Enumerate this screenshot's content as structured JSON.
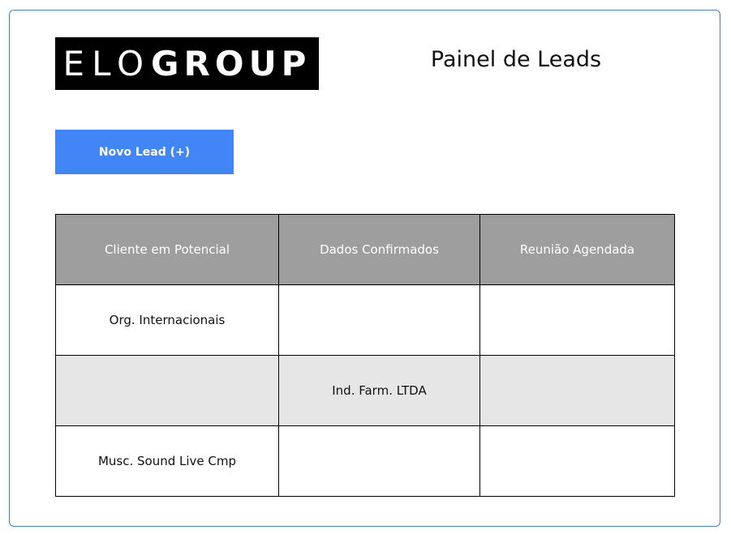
{
  "logo": {
    "part1": "ELO",
    "part2": "GROUP"
  },
  "header": {
    "title": "Painel de Leads"
  },
  "toolbar": {
    "new_lead_label": "Novo Lead (+)"
  },
  "table": {
    "columns": [
      "Cliente em Potencial",
      "Dados Confirmados",
      "Reunião Agendada"
    ],
    "rows": [
      [
        "Org. Internacionais",
        "",
        ""
      ],
      [
        "",
        "Ind. Farm. LTDA",
        ""
      ],
      [
        "Musc. Sound Live Cmp",
        "",
        ""
      ]
    ]
  },
  "colors": {
    "button": "#4285f4",
    "header_bg": "#9e9e9e",
    "alt_row_bg": "#e6e6e6",
    "frame_border": "#4a7fa8"
  }
}
